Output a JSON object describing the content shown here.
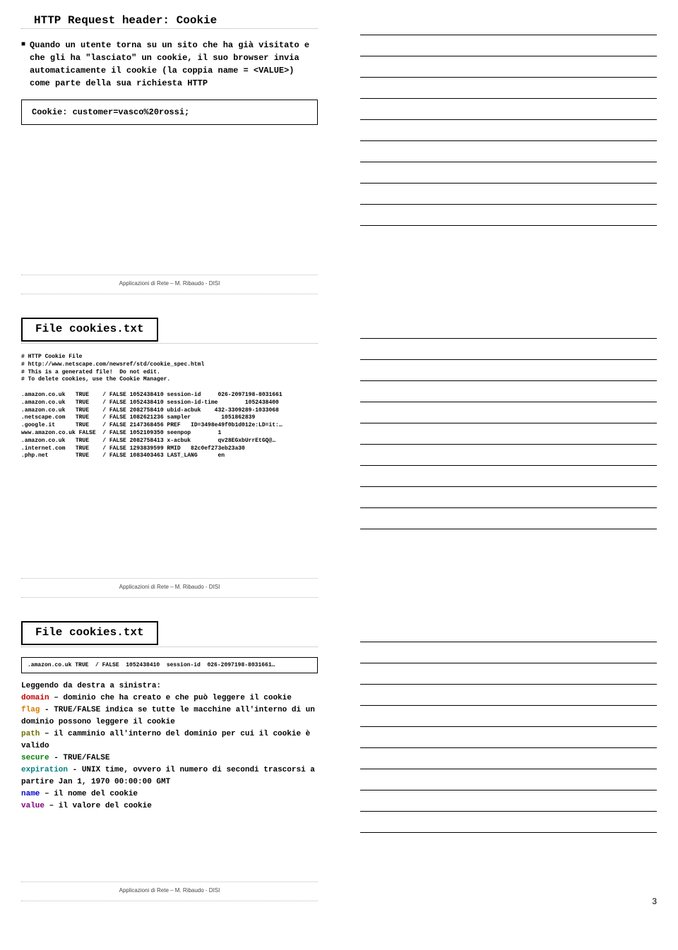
{
  "slide1": {
    "title": "HTTP Request header: Cookie",
    "bullet": "Quando un utente torna su un sito che ha già visitato e che gli ha \"lasciato\" un cookie, il suo browser invia automaticamente il cookie (la coppia name = <VALUE>) come parte della sua richiesta HTTP",
    "code": "Cookie: customer=vasco%20rossi;",
    "footer": "Applicazioni di Rete – M. Ribaudo - DISI"
  },
  "slide2": {
    "title": "File cookies.txt",
    "lines": [
      "# HTTP Cookie File",
      "# http://www.netscape.com/newsref/std/cookie_spec.html",
      "# This is a generated file!  Do not edit.",
      "# To delete cookies, use the Cookie Manager.",
      "",
      ".amazon.co.uk   TRUE    / FALSE 1052438410 session-id     026-2097198-8031661",
      ".amazon.co.uk   TRUE    / FALSE 1052438410 session-id-time        1052438400",
      ".amazon.co.uk   TRUE    / FALSE 2082758410 ubid-acbuk    432-3309289-1033068",
      ".netscape.com   TRUE    / FALSE 1082621236 sampler         1051862839",
      ".google.it      TRUE    / FALSE 2147368456 PREF   ID=3498e49f0b1d012e:LD=it:…",
      "www.amazon.co.uk FALSE  / FALSE 1052109350 seenpop        1",
      ".amazon.co.uk   TRUE    / FALSE 2082758413 x-acbuk        qv28EGxbUrrEtGQ@…",
      ".internet.com   TRUE    / FALSE 1293839599 RMID   82c0ef273eb23a30",
      ".php.net        TRUE    / FALSE 1083403463 LAST_LANG      en"
    ],
    "footer": "Applicazioni di Rete – M. Ribaudo - DISI"
  },
  "slide3": {
    "title": "File cookies.txt",
    "codeline": ".amazon.co.uk TRUE  / FALSE  1052438410  session-id  026-2097198-8031661…",
    "intro": "Leggendo da destra a sinistra:",
    "rows": [
      {
        "key": "domain",
        "cls": "c-red",
        "sep": " – ",
        "text": "dominio che ha creato e che può leggere il cookie"
      },
      {
        "key": "flag",
        "cls": "c-orange",
        "sep": "  -  ",
        "text": "TRUE/FALSE indica se tutte le macchine all'interno di un dominio possono leggere il cookie"
      },
      {
        "key": "path",
        "cls": "c-olive",
        "sep": " – ",
        "text": "il camminio all'interno del dominio per cui il cookie è valido"
      },
      {
        "key": "secure",
        "cls": "c-green",
        "sep": " - ",
        "text": "TRUE/FALSE"
      },
      {
        "key": "expiration",
        "cls": "c-teal",
        "sep": " - ",
        "text": "UNIX time, ovvero il numero di secondi trascorsi a partire Jan 1, 1970 00:00:00 GMT"
      },
      {
        "key": "name",
        "cls": "c-blue",
        "sep": " – ",
        "text": "il nome del cookie"
      },
      {
        "key": "value",
        "cls": "c-purple",
        "sep": " – ",
        "text": "il valore del cookie"
      }
    ],
    "footer": "Applicazioni di Rete – M. Ribaudo - DISI"
  },
  "pagenum": "3"
}
